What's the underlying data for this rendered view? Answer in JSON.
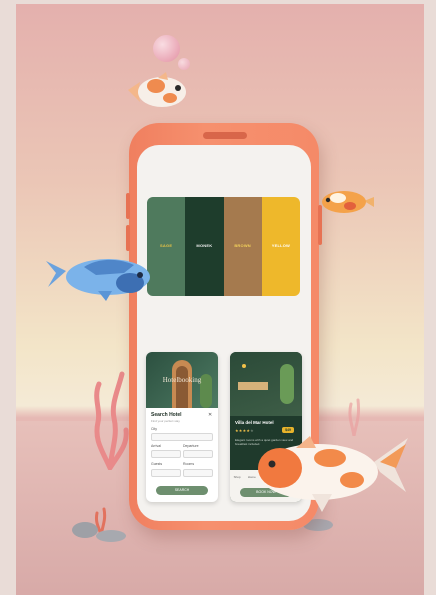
{
  "scene": {
    "subject": "Hotel booking app mockup in orange phone",
    "colors": {
      "background_top": "#e4b0ad",
      "background_mid": "#f3e5c8",
      "floor": "#d7a9a7",
      "phone_body": "#f6906e"
    }
  },
  "palette": {
    "swatches": [
      {
        "label": "SAGE",
        "color": "#4f7a5d",
        "text_color": "#e6c246"
      },
      {
        "label": "MONEK",
        "color": "#1e3d2c",
        "text_color": "#f2f2f2"
      },
      {
        "label": "BROWN",
        "color": "#a57a4e",
        "text_color": "#f3d15a"
      },
      {
        "label": "YELLOW",
        "color": "#eeb82b",
        "text_color": "#ffffff"
      }
    ]
  },
  "card_left": {
    "hero_title": "Hotelbooking",
    "heading": "Search Hotel",
    "subheading": "Find your perfect stay",
    "close_icon": "close-icon",
    "field_labels": [
      "City",
      "Arrival",
      "Departure",
      "Guests",
      "Rooms"
    ],
    "search_label": "SEARCH"
  },
  "card_right": {
    "hotel_name": "Villa del Mar Hotel",
    "rating_stars": 4,
    "price_badge": "$49",
    "description": "Elegant rooms with a quiet garden view and breakfast included.",
    "nav_labels": [
      "Shop",
      "Home",
      "Explore",
      "Book",
      "Me"
    ],
    "book_label": "BOOK NOW"
  }
}
